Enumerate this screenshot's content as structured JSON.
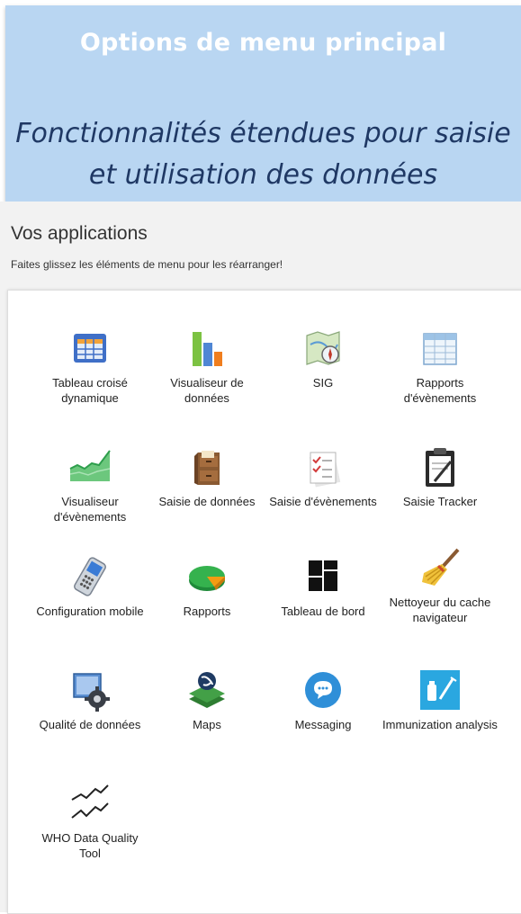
{
  "banner": {
    "title": "Options de menu principal",
    "subtitle": "Fonctionnalités étendues pour saisie et utilisation des données"
  },
  "apps_section": {
    "title": "Vos applications",
    "hint": "Faites glissez les éléments de menu pour les réarranger!"
  },
  "apps": [
    {
      "label": "Tableau croisé dynamique",
      "icon": "pivot-table-icon"
    },
    {
      "label": "Visualiseur de données",
      "icon": "bar-chart-icon"
    },
    {
      "label": "SIG",
      "icon": "map-compass-icon"
    },
    {
      "label": "Rapports d'évènements",
      "icon": "event-report-icon"
    },
    {
      "label": "Visualiseur d'évènements",
      "icon": "area-chart-icon"
    },
    {
      "label": "Saisie de données",
      "icon": "file-cabinet-icon"
    },
    {
      "label": "Saisie d'évènements",
      "icon": "checklist-icon"
    },
    {
      "label": "Saisie Tracker",
      "icon": "clipboard-icon"
    },
    {
      "label": "Configuration mobile",
      "icon": "mobile-phone-icon"
    },
    {
      "label": "Rapports",
      "icon": "pie-chart-icon"
    },
    {
      "label": "Tableau de bord",
      "icon": "dashboard-icon"
    },
    {
      "label": "Nettoyeur du cache navigateur",
      "icon": "broom-icon"
    },
    {
      "label": "Qualité de données",
      "icon": "data-quality-gear-icon"
    },
    {
      "label": "Maps",
      "icon": "maps-layers-icon"
    },
    {
      "label": "Messaging",
      "icon": "chat-bubble-icon"
    },
    {
      "label": "Immunization analysis",
      "icon": "vaccine-icon"
    },
    {
      "label": "WHO Data Quality Tool",
      "icon": "trend-lines-icon"
    }
  ]
}
